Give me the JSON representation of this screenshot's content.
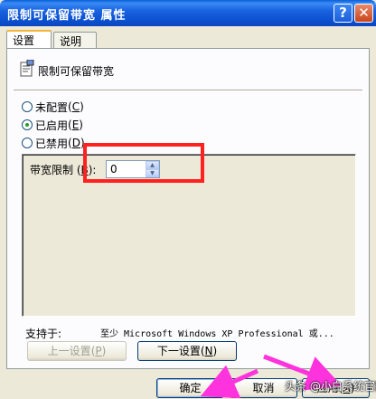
{
  "window": {
    "title": "限制可保留带宽 属性",
    "help_glyph": "?",
    "close_glyph": "✕"
  },
  "tabs": [
    {
      "label": "设置"
    },
    {
      "label": "说明"
    }
  ],
  "policy": {
    "name": "限制可保留带宽",
    "icon": "policy-document-icon"
  },
  "radios": [
    {
      "label": "未配置",
      "accel": "C",
      "checked": false
    },
    {
      "label": "已启用",
      "accel": "E",
      "checked": true
    },
    {
      "label": "已禁用",
      "accel": "D",
      "checked": false
    }
  ],
  "options": {
    "bandwidth_label": "带宽限制",
    "accel": "B",
    "bandwidth_value": "0"
  },
  "support": {
    "label": "支持于:",
    "value": "至少 Microsoft Windows XP Professional 或..."
  },
  "nav": {
    "prev_label": "上一设置",
    "prev_accel": "P",
    "next_label": "下一设置",
    "next_accel": "N"
  },
  "footer": {
    "ok_label": "确定",
    "cancel_label": "取消",
    "apply_label": "应用",
    "apply_accel": "A"
  },
  "watermark": "头条 @小白系统官网",
  "colors": {
    "highlight": "#ff2020",
    "arrow": "#ff33dd",
    "title_bar": "#0a4fd0"
  }
}
